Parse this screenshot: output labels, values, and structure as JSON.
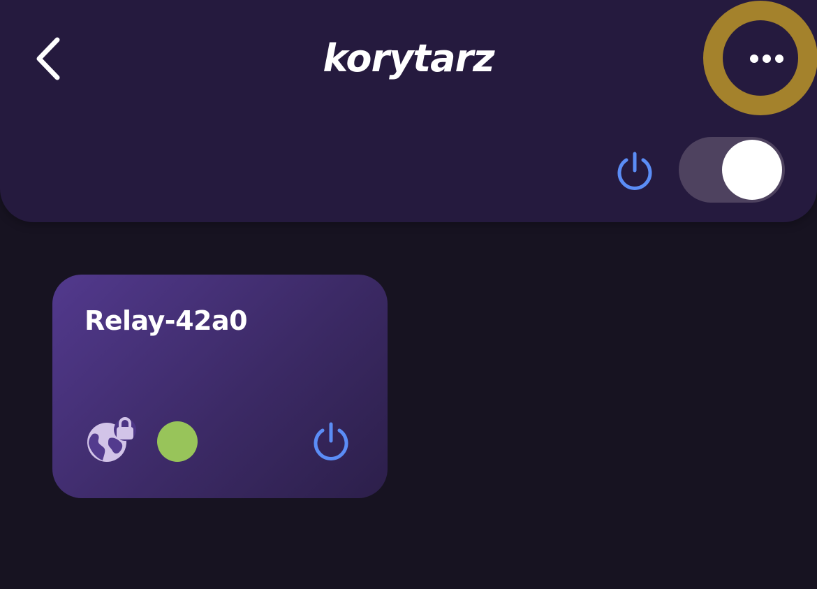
{
  "header": {
    "title": "korytarz",
    "back_icon": "chevron-left-icon",
    "more_icon": "more-horizontal-icon",
    "highlight_color": "#a4822c",
    "power_icon": "power-icon",
    "power_color": "#5b8df6",
    "toggle_on": true
  },
  "devices": [
    {
      "name": "Relay-42a0",
      "connection_icon": "globe-lock-icon",
      "status_color": "#98c45a",
      "power_icon": "power-icon"
    }
  ],
  "colors": {
    "background": "#171321",
    "header_bg": "#251a3e",
    "card_gradient_start": "#52398d",
    "card_gradient_end": "#2c1f4a"
  }
}
